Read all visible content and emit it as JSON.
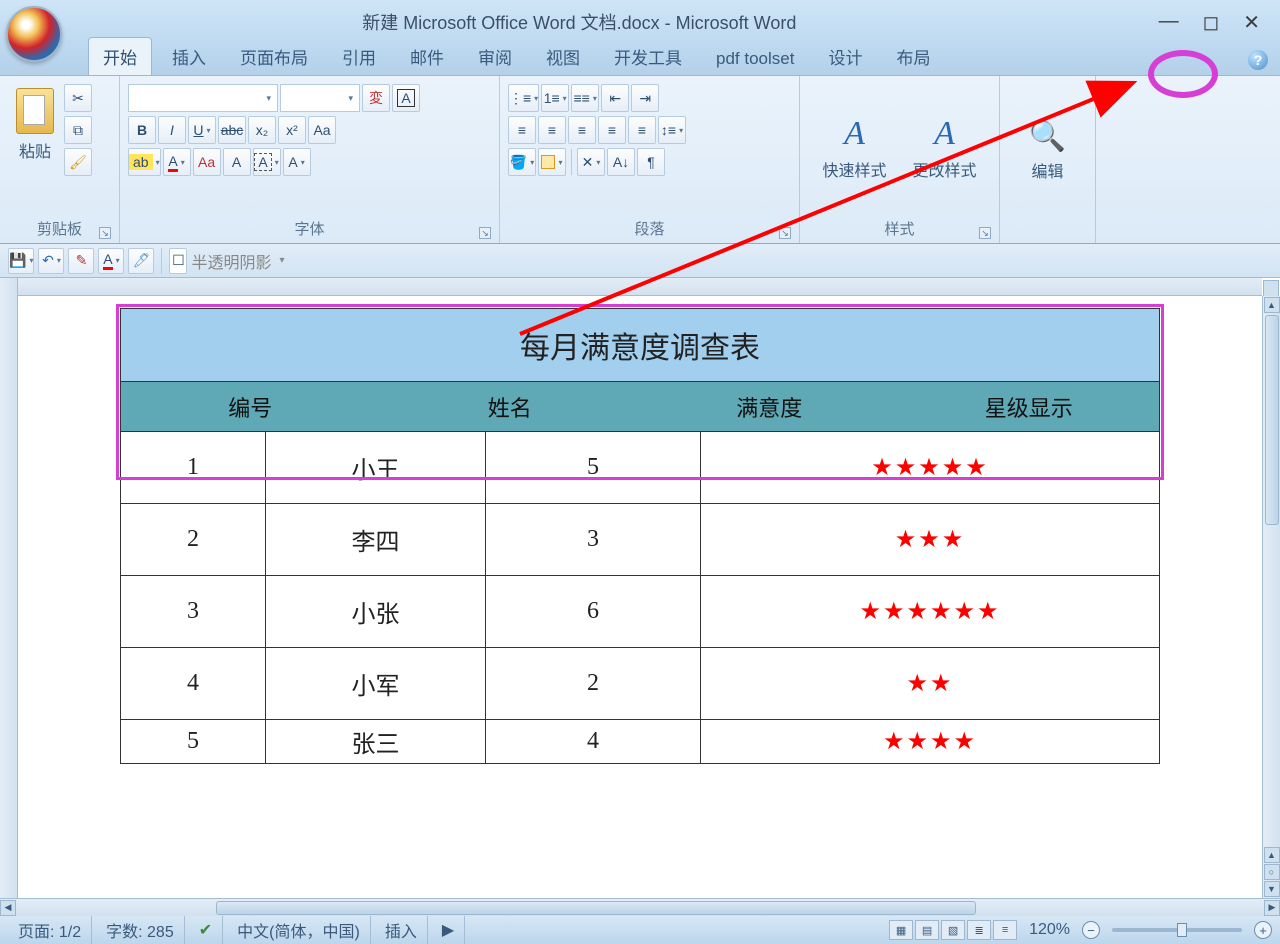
{
  "title": "新建 Microsoft Office Word 文档.docx - Microsoft Word",
  "tabs": [
    "开始",
    "插入",
    "页面布局",
    "引用",
    "邮件",
    "审阅",
    "视图",
    "开发工具",
    "pdf toolset",
    "设计",
    "布局"
  ],
  "active_tab": 0,
  "ribbon": {
    "clipboard": {
      "label": "剪贴板",
      "paste": "粘贴"
    },
    "font": {
      "label": "字体"
    },
    "paragraph": {
      "label": "段落"
    },
    "styles": {
      "label": "样式",
      "quick": "快速样式",
      "change": "更改样式"
    },
    "editing": {
      "label": "编辑"
    }
  },
  "qat_text": "半透明阴影",
  "document": {
    "title": "每月满意度调查表",
    "headers": [
      "编号",
      "姓名",
      "满意度",
      "星级显示"
    ],
    "rows": [
      {
        "id": "1",
        "name": "小王",
        "score": "5",
        "stars": "★★★★★"
      },
      {
        "id": "2",
        "name": "李四",
        "score": "3",
        "stars": "★★★"
      },
      {
        "id": "3",
        "name": "小张",
        "score": "6",
        "stars": "★★★★★★"
      },
      {
        "id": "4",
        "name": "小军",
        "score": "2",
        "stars": "★★"
      },
      {
        "id": "5",
        "name": "张三",
        "score": "4",
        "stars": "★★★★"
      }
    ]
  },
  "status": {
    "page": "页面: 1/2",
    "words": "字数: 285",
    "lang": "中文(简体，中国)",
    "mode": "插入",
    "zoom": "120%"
  }
}
